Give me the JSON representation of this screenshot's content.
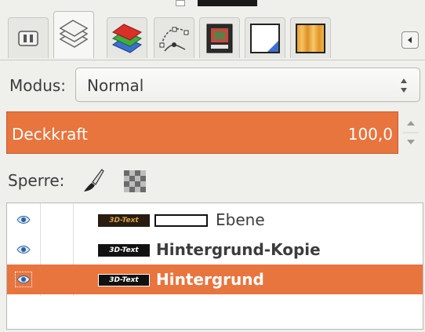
{
  "tabs": [
    {
      "id": "device-status",
      "icon": "device-status-icon"
    },
    {
      "id": "layers",
      "icon": "layers-icon",
      "active": true
    },
    {
      "id": "channels",
      "icon": "channels-icon"
    },
    {
      "id": "paths",
      "icon": "paths-icon"
    },
    {
      "id": "undo-history",
      "icon": "undo-history-icon"
    },
    {
      "id": "colors",
      "icon": "color-swatch-icon"
    },
    {
      "id": "gradient",
      "icon": "gradient-icon"
    }
  ],
  "mode": {
    "label": "Modus:",
    "value": "Normal"
  },
  "opacity": {
    "label": "Deckkraft",
    "value": "100,0"
  },
  "lock": {
    "label": "Sperre:"
  },
  "layers": [
    {
      "name": "Ebene",
      "thumb_text": "3D-Text",
      "has_mask": true,
      "bold": false,
      "selected": false,
      "visible": true
    },
    {
      "name": "Hintergrund-Kopie",
      "thumb_text": "3D-Text",
      "has_mask": false,
      "bold": true,
      "selected": false,
      "visible": true
    },
    {
      "name": "Hintergrund",
      "thumb_text": "3D-Text",
      "has_mask": false,
      "bold": true,
      "selected": true,
      "visible": true
    }
  ],
  "colors": {
    "accent": "#e8743e",
    "background": "#efefec",
    "text": "#3c3c3c"
  }
}
